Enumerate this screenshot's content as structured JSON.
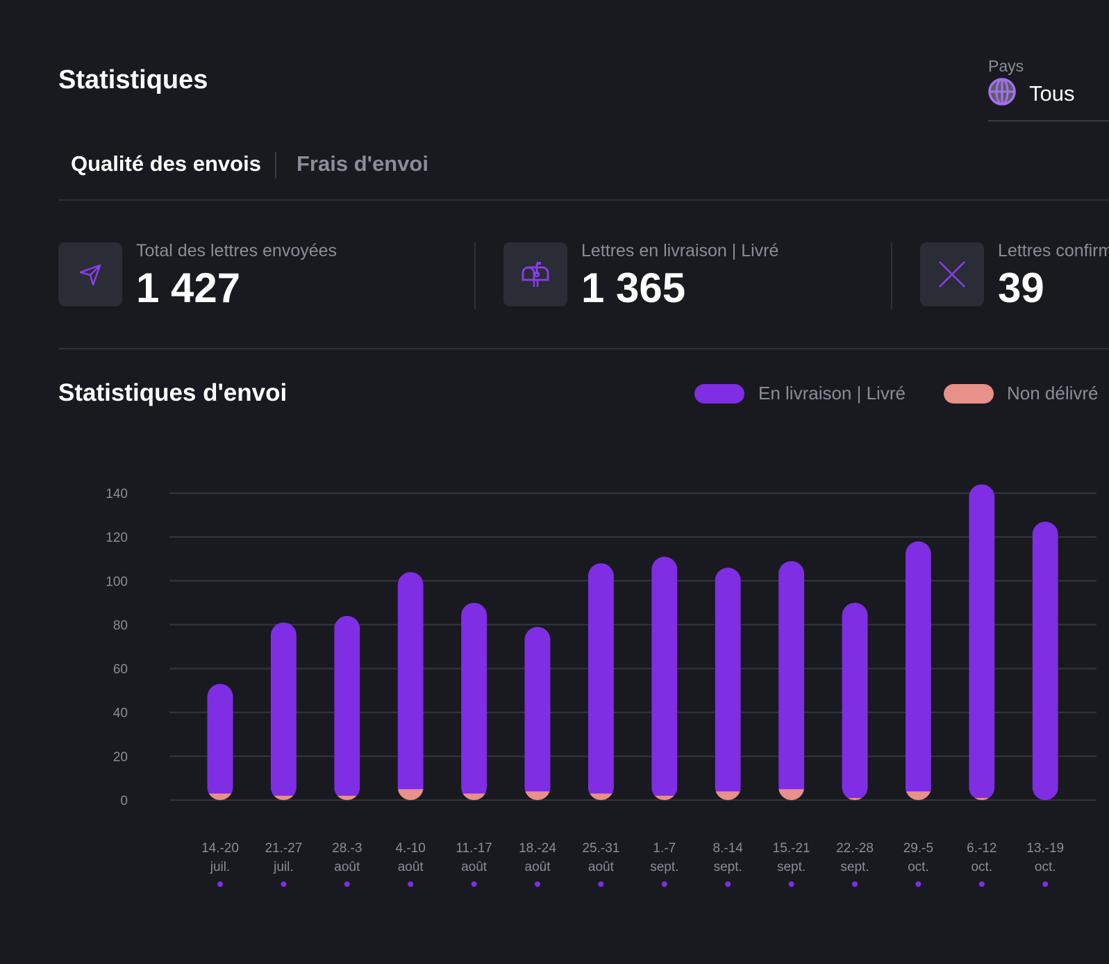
{
  "header": {
    "title": "Statistiques",
    "country_filter": {
      "label": "Pays",
      "value": "Tous",
      "icon": "globe-icon"
    }
  },
  "tabs": [
    {
      "label": "Qualité des envois",
      "active": true
    },
    {
      "label": "Frais d'envoi",
      "active": false
    }
  ],
  "stats": [
    {
      "label": "Total des lettres envoyées",
      "value": "1 427",
      "icon": "send-icon"
    },
    {
      "label": "Lettres en livraison | Livré",
      "value": "1 365",
      "icon": "mailbox-icon"
    },
    {
      "label": "Lettres confirm",
      "value": "39",
      "icon": "x-icon"
    }
  ],
  "colors": {
    "background": "#181a1f",
    "delivered": "#7f2ee3",
    "undelivered": "#e8908a",
    "grid": "#33363d"
  },
  "chart_data": {
    "type": "bar",
    "stacked": true,
    "title": "Statistiques d'envoi",
    "legend_position": "top-right",
    "grid": true,
    "ylim": [
      0,
      140
    ],
    "yticks": [
      0,
      20,
      40,
      60,
      80,
      100,
      120,
      140
    ],
    "categories": [
      [
        "14.-20",
        "juil."
      ],
      [
        "21.-27",
        "juil."
      ],
      [
        "28.-3",
        "août"
      ],
      [
        "4.-10",
        "août"
      ],
      [
        "11.-17",
        "août"
      ],
      [
        "18.-24",
        "août"
      ],
      [
        "25.-31",
        "août"
      ],
      [
        "1.-7",
        "sept."
      ],
      [
        "8.-14",
        "sept."
      ],
      [
        "15.-21",
        "sept."
      ],
      [
        "22.-28",
        "sept."
      ],
      [
        "29.-5",
        "oct."
      ],
      [
        "6.-12",
        "oct."
      ],
      [
        "13.-19",
        "oct."
      ]
    ],
    "series": [
      {
        "name": "Non délivré",
        "color": "#e8908a",
        "values": [
          3,
          2,
          2,
          5,
          3,
          4,
          3,
          2,
          4,
          5,
          1,
          4,
          1,
          0
        ]
      },
      {
        "name": "En livraison | Livré",
        "color": "#7f2ee3",
        "values": [
          50,
          79,
          82,
          99,
          87,
          75,
          105,
          109,
          102,
          104,
          89,
          114,
          143,
          127
        ]
      }
    ]
  }
}
